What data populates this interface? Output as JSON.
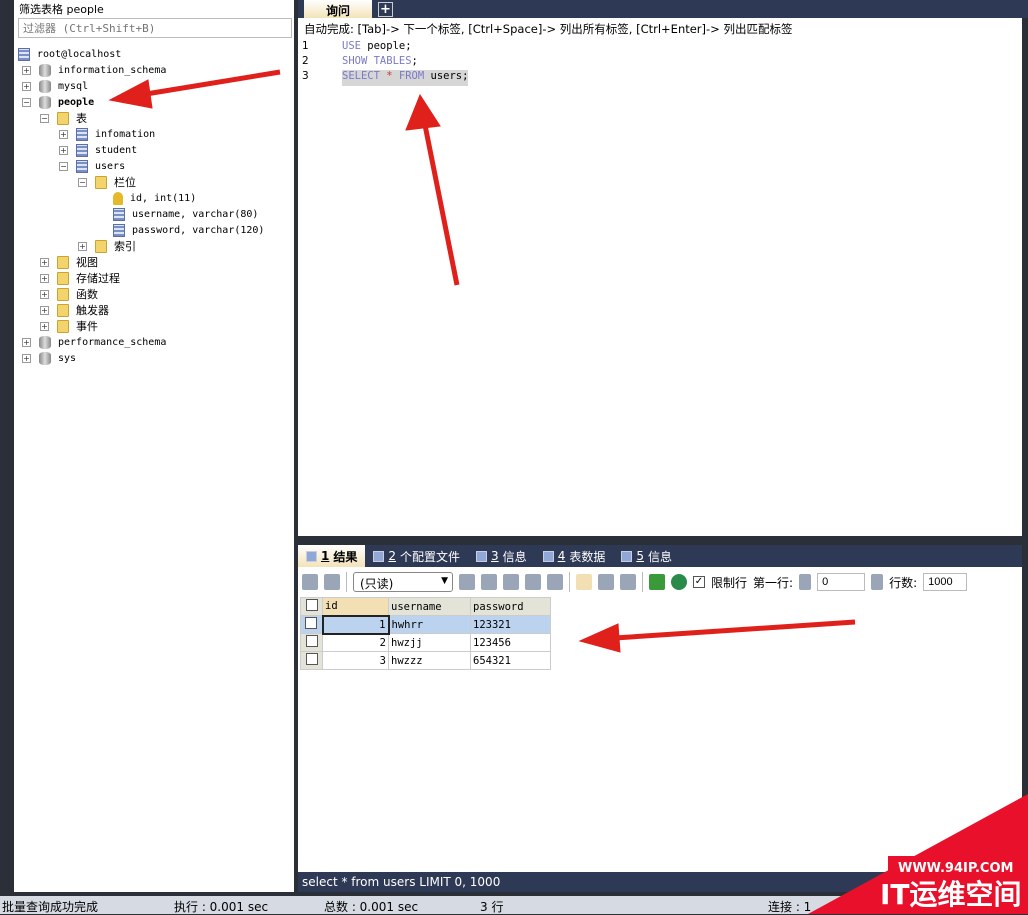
{
  "left": {
    "title": "筛选表格 people",
    "filter_placeholder": "过滤器 (Ctrl+Shift+B)",
    "tree": [
      {
        "label": "root@localhost",
        "level": 0,
        "icon": "server-icon",
        "toggle": ""
      },
      {
        "label": "information_schema",
        "level": 0,
        "icon": "database-icon",
        "toggle": "+"
      },
      {
        "label": "mysql",
        "level": 0,
        "icon": "database-icon",
        "toggle": "+"
      },
      {
        "label": "people",
        "level": 0,
        "icon": "database-icon",
        "toggle": "-",
        "bold": true
      },
      {
        "label": "表",
        "level": 1,
        "icon": "folder-icon",
        "toggle": "-"
      },
      {
        "label": "infomation",
        "level": 2,
        "icon": "table-icon",
        "toggle": "+"
      },
      {
        "label": "student",
        "level": 2,
        "icon": "table-icon",
        "toggle": "+"
      },
      {
        "label": "users",
        "level": 2,
        "icon": "table-icon",
        "toggle": "-"
      },
      {
        "label": "栏位",
        "level": 3,
        "icon": "folder-icon",
        "toggle": "-"
      },
      {
        "label": "id, int(11)",
        "level": 4,
        "icon": "key-icon",
        "toggle": ""
      },
      {
        "label": "username, varchar(80)",
        "level": 4,
        "icon": "column-icon",
        "toggle": ""
      },
      {
        "label": "password, varchar(120)",
        "level": 4,
        "icon": "column-icon",
        "toggle": ""
      },
      {
        "label": "索引",
        "level": 3,
        "icon": "folder-icon",
        "toggle": "+"
      },
      {
        "label": "视图",
        "level": 1,
        "icon": "folder-icon",
        "toggle": "+"
      },
      {
        "label": "存储过程",
        "level": 1,
        "icon": "folder-icon",
        "toggle": "+"
      },
      {
        "label": "函数",
        "level": 1,
        "icon": "folder-icon",
        "toggle": "+"
      },
      {
        "label": "触发器",
        "level": 1,
        "icon": "folder-icon",
        "toggle": "+"
      },
      {
        "label": "事件",
        "level": 1,
        "icon": "folder-icon",
        "toggle": "+"
      },
      {
        "label": "performance_schema",
        "level": 0,
        "icon": "database-icon",
        "toggle": "+"
      },
      {
        "label": "sys",
        "level": 0,
        "icon": "database-icon",
        "toggle": "+"
      }
    ]
  },
  "query": {
    "tab": "询问",
    "add_tab": "+",
    "hint": "自动完成: [Tab]-> 下一个标签, [Ctrl+Space]-> 列出所有标签, [Ctrl+Enter]-> 列出匹配标签",
    "lines": [
      {
        "num": "1",
        "kw": "USE",
        "rest": " people;"
      },
      {
        "num": "2",
        "kw": "SHOW TABLES",
        "rest": ";"
      },
      {
        "num": "3",
        "kw": "SELECT",
        "op": " * ",
        "kw2": "FROM",
        "rest": " users;"
      }
    ]
  },
  "results": {
    "tabs": [
      {
        "num": "1",
        "label": "结果"
      },
      {
        "num": "2",
        "label": "个配置文件"
      },
      {
        "num": "3",
        "label": "信息"
      },
      {
        "num": "4",
        "label": "表数据"
      },
      {
        "num": "5",
        "label": "信息"
      }
    ],
    "mode": "(只读)",
    "limit_label": "限制行",
    "first_row_label": "第一行:",
    "first_row": "0",
    "rows_label": "行数:",
    "rows": "1000",
    "columns": [
      "id",
      "username",
      "password"
    ],
    "rows_data": [
      [
        "1",
        "hwhrr",
        "123321"
      ],
      [
        "2",
        "hwzjj",
        "123456"
      ],
      [
        "3",
        "hwzzz",
        "654321"
      ]
    ],
    "sql": "select * from users LIMIT 0, 1000"
  },
  "status": {
    "msg": "批量查询成功完成",
    "exec": "执行 : 0.001 sec",
    "total": "总数 : 0.001 sec",
    "rows": "3 行",
    "conn": "连接 : 1"
  },
  "watermark": {
    "url": "WWW.94IP.COM",
    "name": "IT运维空间"
  },
  "colors": {
    "accent": "#2e3a55",
    "arrow": "#e0201b",
    "watermark": "#e8102a"
  }
}
